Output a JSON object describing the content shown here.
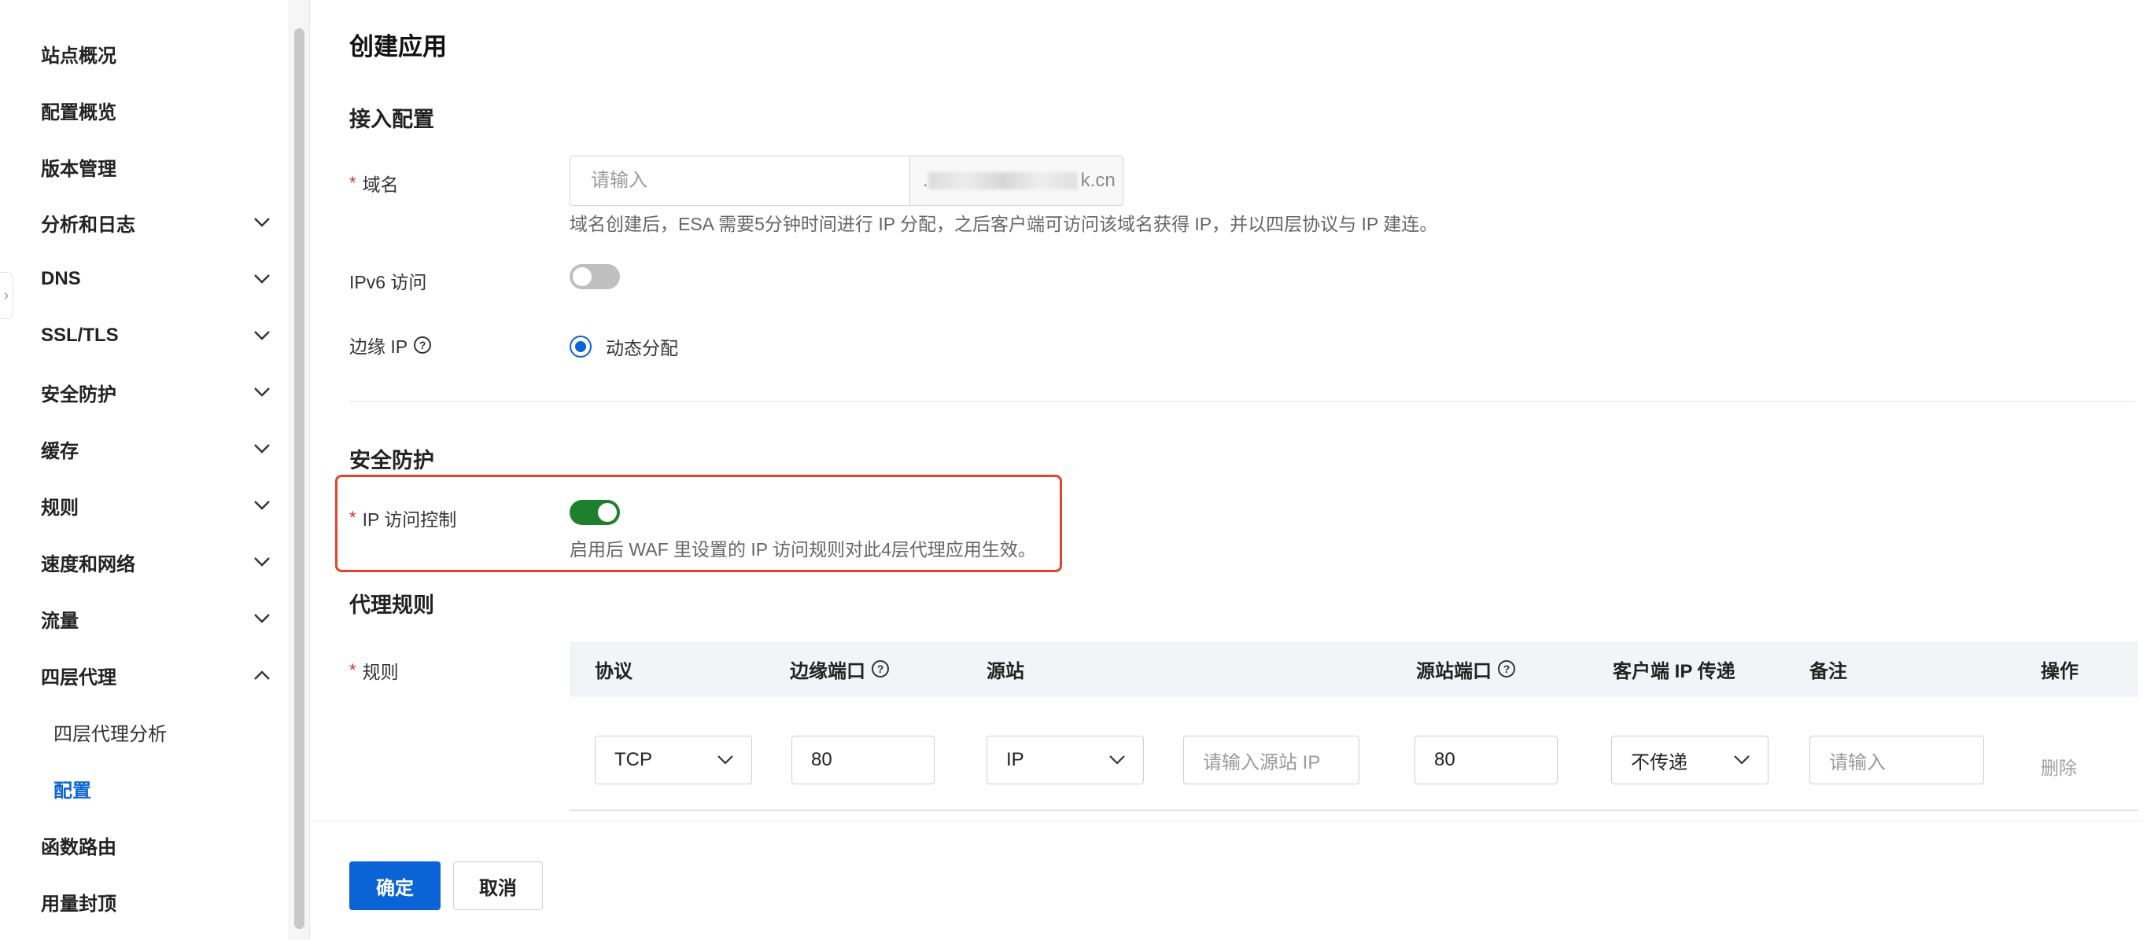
{
  "sidebar": {
    "items": [
      {
        "label": "站点概况",
        "expandable": false
      },
      {
        "label": "配置概览",
        "expandable": false
      },
      {
        "label": "版本管理",
        "expandable": false
      },
      {
        "label": "分析和日志",
        "expandable": true
      },
      {
        "label": "DNS",
        "expandable": true
      },
      {
        "label": "SSL/TLS",
        "expandable": true
      },
      {
        "label": "安全防护",
        "expandable": true
      },
      {
        "label": "缓存",
        "expandable": true
      },
      {
        "label": "规则",
        "expandable": true
      },
      {
        "label": "速度和网络",
        "expandable": true
      },
      {
        "label": "流量",
        "expandable": true
      },
      {
        "label": "四层代理",
        "expandable": true,
        "expanded": true
      },
      {
        "label": "四层代理分析",
        "sub": true
      },
      {
        "label": "配置",
        "sub": true,
        "active": true
      },
      {
        "label": "函数路由",
        "expandable": false
      },
      {
        "label": "用量封顶",
        "expandable": false
      }
    ]
  },
  "page": {
    "title": "创建应用"
  },
  "access_config": {
    "section_title": "接入配置",
    "domain_label": "域名",
    "domain_placeholder": "请输入",
    "domain_suffix": "k.cn",
    "domain_hint": "域名创建后，ESA 需要5分钟时间进行 IP 分配，之后客户端可访问该域名获得 IP，并以四层协议与 IP 建连。",
    "ipv6_label": "IPv6 访问",
    "ipv6_enabled": false,
    "edge_ip_label": "边缘 IP",
    "edge_ip_option": "动态分配"
  },
  "security": {
    "section_title": "安全防护",
    "ip_access_label": "IP 访问控制",
    "ip_access_enabled": true,
    "ip_access_hint": "启用后 WAF 里设置的 IP 访问规则对此4层代理应用生效。"
  },
  "proxy_rules": {
    "section_title": "代理规则",
    "rules_label": "规则",
    "columns": {
      "protocol": "协议",
      "edge_port": "边缘端口",
      "origin": "源站",
      "origin_port": "源站端口",
      "client_ip": "客户端 IP 传递",
      "remark": "备注",
      "action": "操作"
    },
    "row": {
      "protocol": "TCP",
      "edge_port": "80",
      "origin_type": "IP",
      "origin_placeholder": "请输入源站 IP",
      "origin_port": "80",
      "client_ip": "不传递",
      "remark_placeholder": "请输入",
      "delete": "删除"
    }
  },
  "footer": {
    "confirm": "确定",
    "cancel": "取消"
  },
  "colors": {
    "primary": "#0a64d6",
    "toggle_on": "#1e7f2e",
    "highlight": "#e3452a",
    "required": "#e02b2b"
  }
}
